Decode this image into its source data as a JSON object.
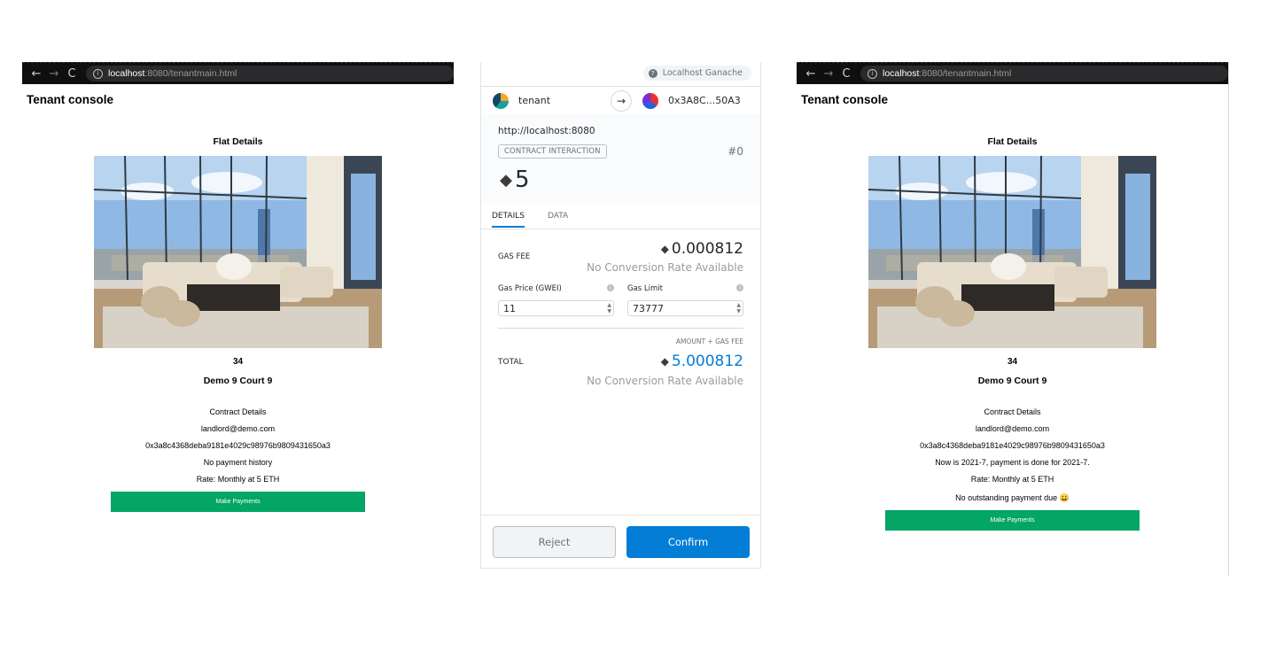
{
  "browser": {
    "url_host": "localhost",
    "url_rest": ":8080/tenantmain.html",
    "back": "←",
    "forward": "→",
    "reload": "C"
  },
  "left_page": {
    "title": "Tenant console",
    "flat_heading": "Flat Details",
    "flat_number": "34",
    "address": "Demo 9 Court 9",
    "contract_heading": "Contract Details",
    "landlord_email": "landlord@demo.com",
    "contract_address": "0x3a8c4368deba9181e4029c98976b9809431650a3",
    "payment_status": "No payment history",
    "rate": "Rate: Monthly at 5 ETH",
    "button": "Make Payments"
  },
  "right_page": {
    "title": "Tenant console",
    "flat_heading": "Flat Details",
    "flat_number": "34",
    "address": "Demo 9 Court 9",
    "contract_heading": "Contract Details",
    "landlord_email": "landlord@demo.com",
    "contract_address": "0x3a8c4368deba9181e4029c98976b9809431650a3",
    "payment_status": "Now is 2021-7, payment is done for 2021-7.",
    "rate": "Rate: Monthly at 5 ETH",
    "outstanding": "No outstanding payment due 😀",
    "button": "Make Payments"
  },
  "metamask": {
    "network": "Localhost Ganache",
    "from_account": "tenant",
    "to_account": "0x3A8C...50A3",
    "origin": "http://localhost:8080",
    "badge": "CONTRACT INTERACTION",
    "nonce": "#0",
    "amount": "5",
    "tabs": [
      "DETAILS",
      "DATA"
    ],
    "gas_fee_label": "GAS FEE",
    "gas_fee_value": "0.000812",
    "no_conversion": "No Conversion Rate Available",
    "gas_price_label": "Gas Price (GWEI)",
    "gas_price_value": "11",
    "gas_limit_label": "Gas Limit",
    "gas_limit_value": "73777",
    "amount_gas_label": "AMOUNT + GAS FEE",
    "total_label": "TOTAL",
    "total_value": "5.000812",
    "reject": "Reject",
    "confirm": "Confirm",
    "accent_color": "#037dd6",
    "eth_icon": "ethereum-icon"
  },
  "colors": {
    "pay_button": "#03a664",
    "urlbar": "#0f0f10"
  }
}
